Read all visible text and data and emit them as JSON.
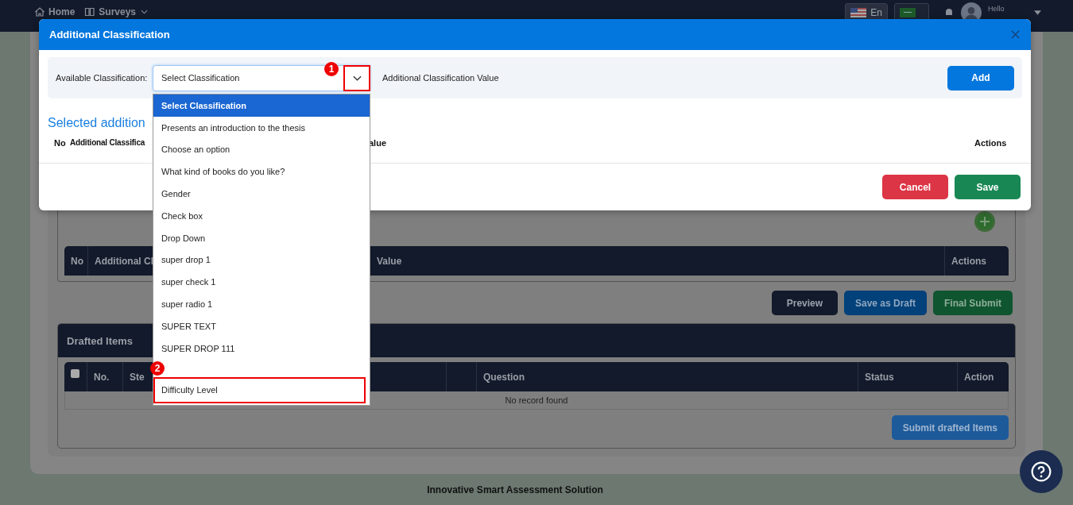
{
  "navbar": {
    "links": [
      {
        "label": "Home",
        "has_menu": false
      },
      {
        "label": "Surveys",
        "has_menu": true
      }
    ],
    "language": "En",
    "greeting": "Hello"
  },
  "page": {
    "classification_table": {
      "columns": [
        "No",
        "Additional Cl",
        "Value",
        "Actions"
      ]
    },
    "actions": [
      {
        "label": "Preview",
        "kind": "dark"
      },
      {
        "label": "Save as Draft",
        "kind": "blue"
      },
      {
        "label": "Final Submit",
        "kind": "green"
      }
    ],
    "drafted_items": {
      "title": "Drafted Items",
      "select_all_checked": false,
      "columns": [
        "No.",
        "Ste",
        "Question",
        "Status",
        "Action"
      ],
      "empty_message": "No record found",
      "submit": "Submit drafted Items"
    },
    "footer": "Innovative Smart Assessment Solution"
  },
  "modal": {
    "title": "Additional Classification",
    "available_label": "Available Classification:",
    "select_value": "Select Classification",
    "value_label": "Additional Classification Value",
    "add": "Add",
    "section_title": "Selected addition",
    "columns": [
      "No",
      "Additional Classifica",
      "alue",
      "Actions"
    ],
    "buttons": [
      {
        "label": "Cancel",
        "kind": "danger"
      },
      {
        "label": "Save",
        "kind": "success"
      }
    ],
    "options": [
      {
        "label": "Select Classification",
        "selected": true,
        "highlighted": false
      },
      {
        "label": "Presents an introduction to the thesis",
        "selected": false,
        "highlighted": false
      },
      {
        "label": "Choose an option",
        "selected": false,
        "highlighted": false
      },
      {
        "label": "What kind of books do you like?",
        "selected": false,
        "highlighted": false
      },
      {
        "label": "Gender",
        "selected": false,
        "highlighted": false
      },
      {
        "label": "Check box",
        "selected": false,
        "highlighted": false
      },
      {
        "label": "Drop Down",
        "selected": false,
        "highlighted": false
      },
      {
        "label": "super drop 1",
        "selected": false,
        "highlighted": false
      },
      {
        "label": "super check 1",
        "selected": false,
        "highlighted": false
      },
      {
        "label": "super radio 1",
        "selected": false,
        "highlighted": false
      },
      {
        "label": "SUPER TEXT",
        "selected": false,
        "highlighted": false
      },
      {
        "label": "SUPER DROP 111",
        "selected": false,
        "highlighted": false
      },
      {
        "label": "Difficulty Level",
        "selected": false,
        "highlighted": true
      }
    ],
    "callouts": [
      "1",
      "2"
    ]
  }
}
